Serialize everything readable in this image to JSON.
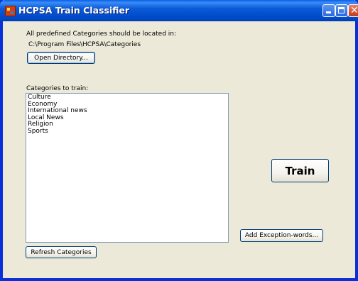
{
  "window": {
    "title": "HCPSA Train Classifier",
    "controls": {
      "minimize": "minimize",
      "maximize": "maximize",
      "close": "close"
    }
  },
  "info": {
    "location_label": "All predefined Categories should be located in:",
    "path": "C:\\Program Files\\HCPSA\\Categories"
  },
  "buttons": {
    "open_directory": "Open Directory...",
    "train": "Train",
    "add_exception_words": "Add Exception-words...",
    "refresh_categories": "Refresh Categories"
  },
  "categories": {
    "label": "Categories to train:",
    "items": [
      "Culture",
      "Economy",
      "International news",
      "Local News",
      "Religion",
      "Sports"
    ]
  },
  "colors": {
    "titlebar": "#0054e3",
    "window_bg": "#ece9d8",
    "button_border": "#003c74"
  }
}
